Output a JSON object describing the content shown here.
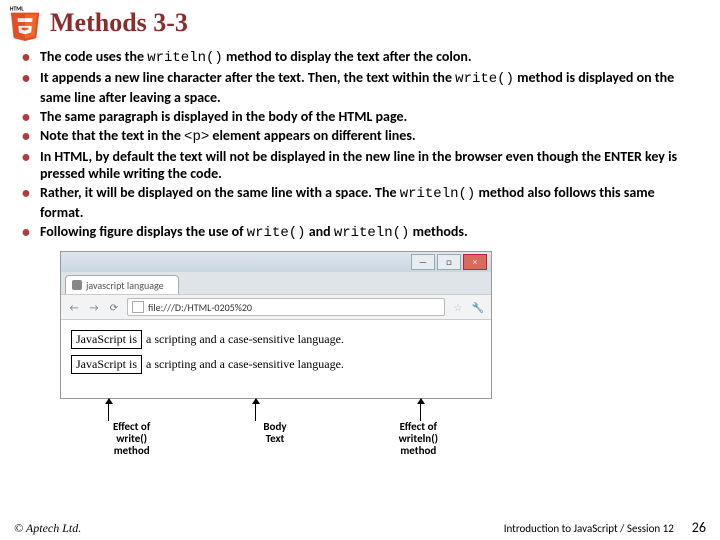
{
  "header": {
    "title": "Methods 3-3"
  },
  "bullets": [
    {
      "pre": "The code uses the ",
      "code": "writeln()",
      "post": " method to display the text after the colon."
    },
    {
      "pre": "It appends a new line character after the text. Then, the text within the ",
      "code": "write()",
      "post": " method is displayed on the same line after leaving a space."
    },
    {
      "pre": "The same paragraph is displayed in the body of the HTML page.",
      "code": "",
      "post": ""
    },
    {
      "pre": "Note that the text in the ",
      "code": "<p>",
      "post": " element appears on different lines."
    },
    {
      "pre": "In HTML, by default the text will not be displayed in the new line in the browser even though the ENTER key is pressed while writing the code.",
      "code": "",
      "post": ""
    },
    {
      "pre": "Rather, it will be displayed on the same line with a space. The ",
      "code": "writeln()",
      "post": " method also follows this same format."
    },
    {
      "pre": "Following figure displays the use of ",
      "code": "write()",
      "mid": " and ",
      "code2": "writeln()",
      "post": " methods."
    }
  ],
  "browser": {
    "tab_title": "javascript language",
    "url": "file:///D:/HTML-0205%20",
    "line1_boxed": "JavaScript is",
    "line1_rest": "a scripting and a case-sensitive language.",
    "line2_boxed": "JavaScript is",
    "line2_rest": "a scripting and a case-sensitive language."
  },
  "labels": {
    "left": "Effect of\nwrite()\nmethod",
    "mid": "Body\nText",
    "right": "Effect of\nwriteln()\nmethod"
  },
  "footer": {
    "copyright": "© Aptech Ltd.",
    "session": "Introduction to JavaScript / Session 12",
    "page": "26"
  }
}
